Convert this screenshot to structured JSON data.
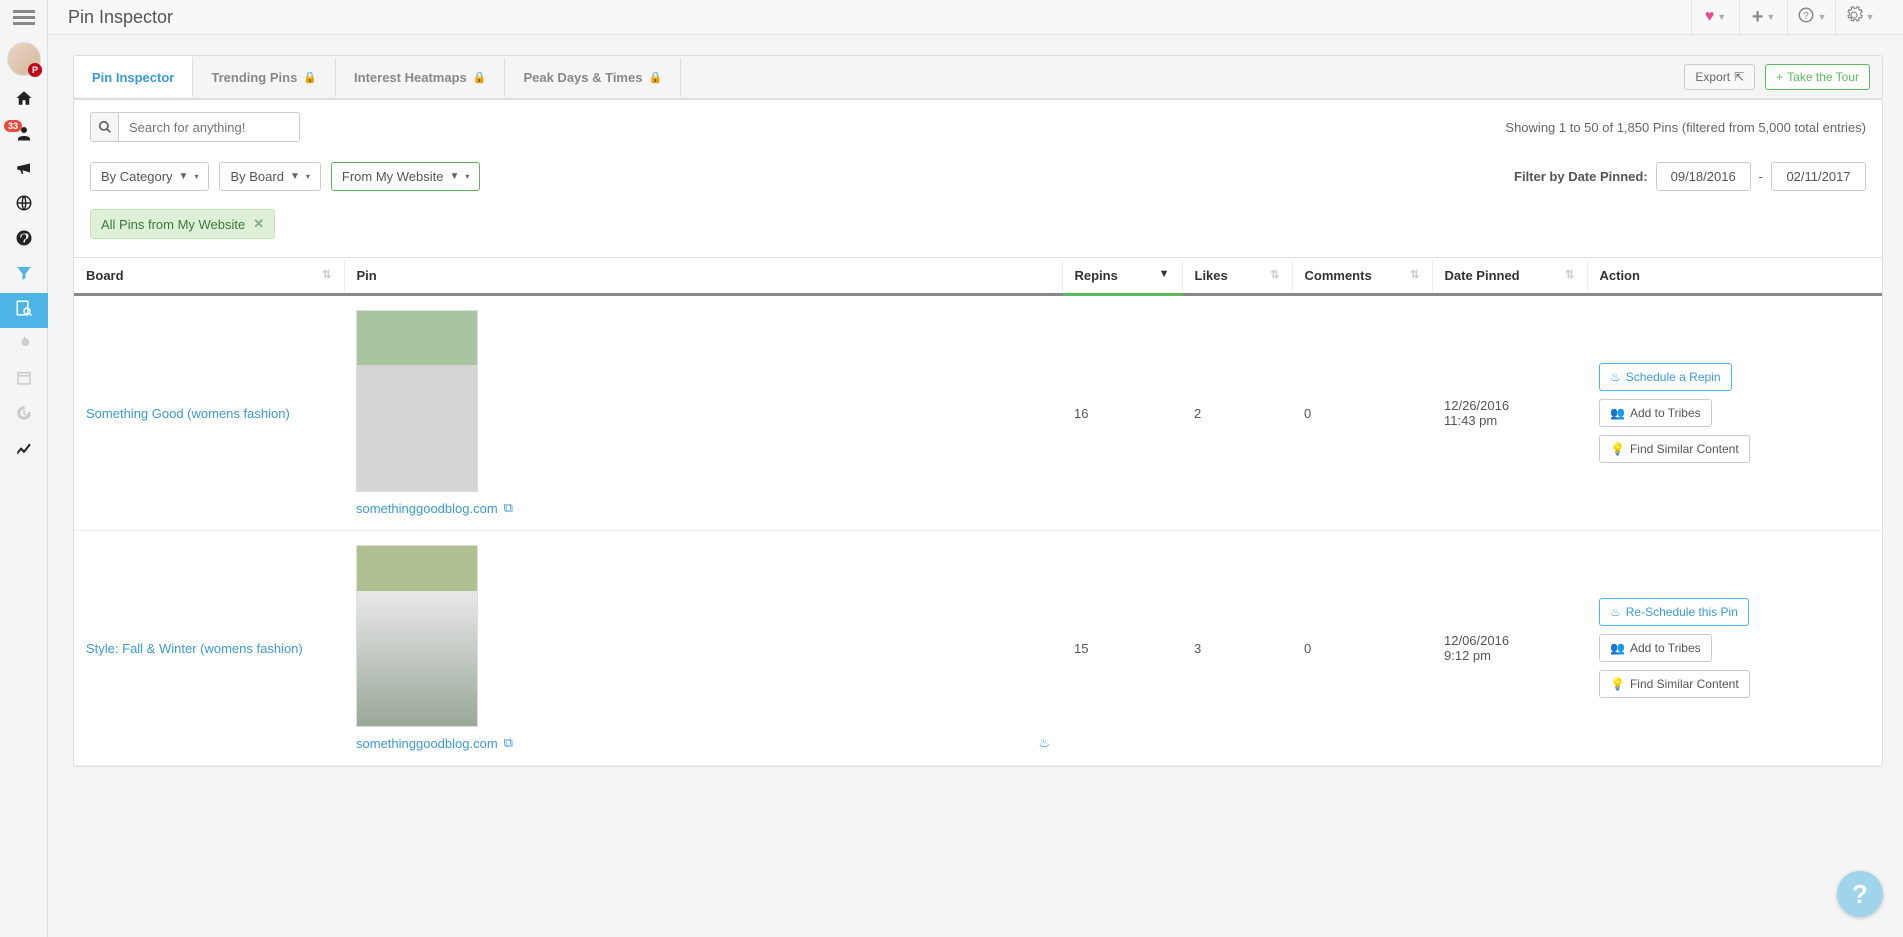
{
  "header": {
    "title": "Pin Inspector"
  },
  "sidebar": {
    "badge_count": "33"
  },
  "tabs": {
    "items": [
      {
        "label": "Pin Inspector",
        "locked": false,
        "active": true
      },
      {
        "label": "Trending Pins",
        "locked": true,
        "active": false
      },
      {
        "label": "Interest Heatmaps",
        "locked": true,
        "active": false
      },
      {
        "label": "Peak Days & Times",
        "locked": true,
        "active": false
      }
    ],
    "export_label": "Export",
    "tour_label": "Take the Tour"
  },
  "search": {
    "placeholder": "Search for anything!",
    "showing_text": "Showing 1 to 50 of 1,850 Pins (filtered from 5,000 total entries)"
  },
  "filters": {
    "category_label": "By Category",
    "board_label": "By Board",
    "website_label": "From My Website",
    "date_label": "Filter by Date Pinned:",
    "date_from": "09/18/2016",
    "date_sep": "-",
    "date_to": "02/11/2017",
    "active_tag": "All Pins from My Website"
  },
  "table": {
    "columns": {
      "board": "Board",
      "pin": "Pin",
      "repins": "Repins",
      "likes": "Likes",
      "comments": "Comments",
      "date_pinned": "Date Pinned",
      "action": "Action"
    },
    "rows": [
      {
        "board": "Something Good (womens fashion)",
        "source": "somethinggoodblog.com",
        "repins": "16",
        "likes": "2",
        "comments": "0",
        "date": "12/26/2016",
        "time": "11:43 pm",
        "schedule_label": "Schedule a Repin",
        "tribes_label": "Add to Tribes",
        "similar_label": "Find Similar Content"
      },
      {
        "board": "Style: Fall & Winter (womens fashion)",
        "source": "somethinggoodblog.com",
        "repins": "15",
        "likes": "3",
        "comments": "0",
        "date": "12/06/2016",
        "time": "9:12 pm",
        "schedule_label": "Re-Schedule this Pin",
        "tribes_label": "Add to Tribes",
        "similar_label": "Find Similar Content"
      }
    ]
  }
}
